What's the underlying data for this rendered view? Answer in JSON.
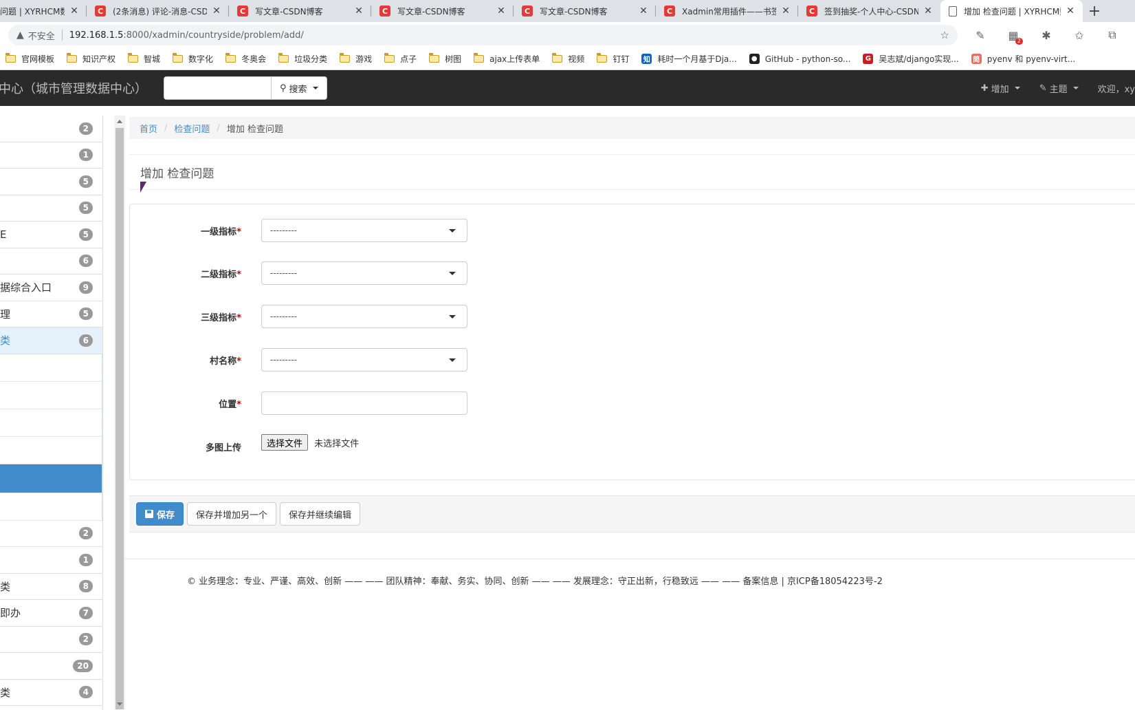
{
  "browser": {
    "tabs": [
      {
        "title": "问题 | XYRHCM数",
        "icon": "doc-icon"
      },
      {
        "title": "(2条消息) 评论-消息-CSDN",
        "icon": "csdn-icon"
      },
      {
        "title": "写文章-CSDN博客",
        "icon": "csdn-icon"
      },
      {
        "title": "写文章-CSDN博客",
        "icon": "csdn-icon"
      },
      {
        "title": "写文章-CSDN博客",
        "icon": "csdn-icon"
      },
      {
        "title": "Xadmin常用插件——书签",
        "icon": "csdn-icon"
      },
      {
        "title": "签到抽奖-个人中心-CSDN",
        "icon": "csdn-icon"
      },
      {
        "title": "增加 检查问题 | XYRHCM数",
        "icon": "doc-icon",
        "active": true
      }
    ],
    "new_tab": "+",
    "security_label": "不安全",
    "url_host": "192.168.1.5",
    "url_path": ":8000/xadmin/countryside/problem/add/",
    "extension_badge": "2",
    "bookmarks": [
      {
        "label": "官网模板",
        "icon": "folder"
      },
      {
        "label": "知识产权",
        "icon": "folder"
      },
      {
        "label": "智城",
        "icon": "folder"
      },
      {
        "label": "数字化",
        "icon": "folder"
      },
      {
        "label": "冬奥会",
        "icon": "folder"
      },
      {
        "label": "垃圾分类",
        "icon": "folder"
      },
      {
        "label": "游戏",
        "icon": "folder"
      },
      {
        "label": "点子",
        "icon": "folder"
      },
      {
        "label": "树图",
        "icon": "folder"
      },
      {
        "label": "ajax上传表单",
        "icon": "folder"
      },
      {
        "label": "视频",
        "icon": "folder"
      },
      {
        "label": "钉钉",
        "icon": "folder"
      },
      {
        "label": "耗时一个月基于Dja...",
        "icon": "zhihu"
      },
      {
        "label": "GitHub - python-so...",
        "icon": "github"
      },
      {
        "label": "吴志斌/django实现...",
        "icon": "gitee"
      },
      {
        "label": "pyenv 和 pyenv-virt...",
        "icon": "jianshu"
      }
    ]
  },
  "navbar": {
    "brand": "中心（城市管理数据中心）",
    "search_button": "搜索",
    "add_menu": "增加",
    "theme_menu": "主题",
    "welcome": "欢迎，xy"
  },
  "sidebar": {
    "items": [
      {
        "label": "",
        "count": "2"
      },
      {
        "label": "",
        "count": "1"
      },
      {
        "label": "",
        "count": "5"
      },
      {
        "label": "",
        "count": "5"
      },
      {
        "label": "E",
        "count": "5"
      },
      {
        "label": "",
        "count": "6"
      },
      {
        "label": "据综合入口",
        "count": "9"
      },
      {
        "label": "理",
        "count": "5"
      },
      {
        "label": "类",
        "count": "6",
        "open": true
      }
    ],
    "subitems": [
      "",
      "",
      "",
      "",
      "",
      ""
    ],
    "items_after": [
      {
        "label": "",
        "count": "2"
      },
      {
        "label": "",
        "count": "1"
      },
      {
        "label": "类",
        "count": "8"
      },
      {
        "label": "即办",
        "count": "7"
      },
      {
        "label": "",
        "count": "2"
      },
      {
        "label": "",
        "count": "20"
      },
      {
        "label": "类",
        "count": "4"
      }
    ]
  },
  "breadcrumb": {
    "home": "首页",
    "section": "检查问题",
    "current": "增加 检查问题"
  },
  "page_title": "增加 检查问题",
  "form": {
    "fields": [
      {
        "label": "一级指标",
        "required": true,
        "type": "select",
        "value": "---------"
      },
      {
        "label": "二级指标",
        "required": true,
        "type": "select",
        "value": "---------"
      },
      {
        "label": "三级指标",
        "required": true,
        "type": "select",
        "value": "---------"
      },
      {
        "label": "村名称",
        "required": true,
        "type": "select",
        "value": "---------"
      },
      {
        "label": "位置",
        "required": true,
        "type": "text",
        "value": ""
      },
      {
        "label": "多图上传",
        "required": false,
        "type": "file",
        "button": "选择文件",
        "status": "未选择文件"
      }
    ],
    "required_mark": "*"
  },
  "actions": {
    "save": "保存",
    "save_add_another": "保存并增加另一个",
    "save_continue": "保存并继续编辑"
  },
  "footer": "© 业务理念：专业、严谨、高效、创新 —— —— 团队精神：奉献、务实、协同、创新 —— —— 发展理念：守正出新，行稳致远 —— —— 备案信息 | 京ICP备18054223号-2",
  "colors": {
    "primary": "#428bca",
    "navbar": "#2a2a2a",
    "csdn_red": "#e53935",
    "required": "#cc0000"
  }
}
